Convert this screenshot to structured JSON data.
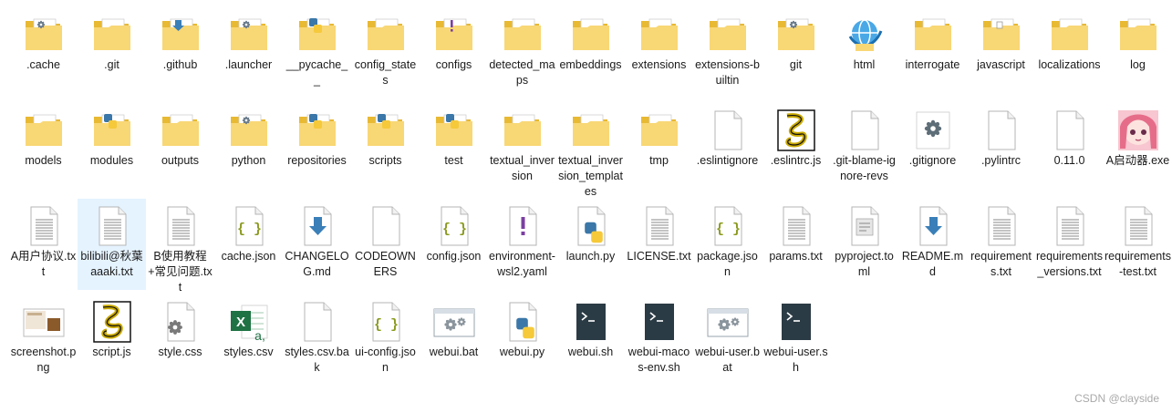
{
  "window": {
    "watermark": "CSDN @clayside"
  },
  "colors": {
    "folder_back": "#e8b933",
    "folder_front": "#f8d775",
    "selection": "#e5f3ff",
    "doc_line": "#8a8a8a",
    "json_brace": "#8a9a1e",
    "arrow_blue": "#3a7fb8",
    "python_blue": "#3b77a8",
    "python_yellow": "#f5c93a",
    "excel_green": "#1f7244",
    "terminal_bg": "#2b3b45",
    "gear_gray": "#7a7a7a"
  },
  "files": [
    {
      "name": ".cache",
      "icon": "folder-gear-icon",
      "type": "folder"
    },
    {
      "name": ".git",
      "icon": "folder-icon",
      "type": "folder"
    },
    {
      "name": ".github",
      "icon": "folder-download-icon",
      "type": "folder"
    },
    {
      "name": ".launcher",
      "icon": "folder-gear-icon",
      "type": "folder"
    },
    {
      "name": "__pycache__",
      "icon": "folder-python-icon",
      "type": "folder"
    },
    {
      "name": "config_states",
      "icon": "folder-icon",
      "type": "folder"
    },
    {
      "name": "configs",
      "icon": "folder-exclamation-icon",
      "type": "folder"
    },
    {
      "name": "detected_maps",
      "icon": "folder-icon",
      "type": "folder"
    },
    {
      "name": "embeddings",
      "icon": "folder-icon",
      "type": "folder"
    },
    {
      "name": "extensions",
      "icon": "folder-icon",
      "type": "folder"
    },
    {
      "name": "extensions-builtin",
      "icon": "folder-icon",
      "type": "folder"
    },
    {
      "name": "git",
      "icon": "folder-gear-icon",
      "type": "folder"
    },
    {
      "name": "html",
      "icon": "folder-web-icon",
      "type": "folder"
    },
    {
      "name": "interrogate",
      "icon": "folder-icon",
      "type": "folder"
    },
    {
      "name": "javascript",
      "icon": "folder-doc-icon",
      "type": "folder"
    },
    {
      "name": "localizations",
      "icon": "folder-icon",
      "type": "folder"
    },
    {
      "name": "log",
      "icon": "folder-icon",
      "type": "folder"
    },
    {
      "name": "models",
      "icon": "folder-icon",
      "type": "folder"
    },
    {
      "name": "modules",
      "icon": "folder-python-icon",
      "type": "folder"
    },
    {
      "name": "outputs",
      "icon": "folder-icon",
      "type": "folder"
    },
    {
      "name": "python",
      "icon": "folder-gear-icon",
      "type": "folder"
    },
    {
      "name": "repositories",
      "icon": "folder-python-icon",
      "type": "folder"
    },
    {
      "name": "scripts",
      "icon": "folder-python-icon",
      "type": "folder"
    },
    {
      "name": "test",
      "icon": "folder-python-icon",
      "type": "folder"
    },
    {
      "name": "textual_inversion",
      "icon": "folder-icon",
      "type": "folder"
    },
    {
      "name": "textual_inversion_templates",
      "icon": "folder-icon",
      "type": "folder"
    },
    {
      "name": "tmp",
      "icon": "folder-icon",
      "type": "folder"
    },
    {
      "name": ".eslintignore",
      "icon": "blank-file-icon",
      "type": "file"
    },
    {
      "name": ".eslintrc.js",
      "icon": "script-file-icon",
      "type": "file"
    },
    {
      "name": ".git-blame-ignore-revs",
      "icon": "blank-file-icon",
      "type": "file"
    },
    {
      "name": ".gitignore",
      "icon": "gear-file-icon",
      "type": "file"
    },
    {
      "name": ".pylintrc",
      "icon": "blank-file-icon",
      "type": "file"
    },
    {
      "name": "0.11.0",
      "icon": "blank-file-icon",
      "type": "file"
    },
    {
      "name": "A启动器.exe",
      "icon": "anime-app-icon",
      "type": "file"
    },
    {
      "name": "A用户协议.txt",
      "icon": "text-file-icon",
      "type": "file"
    },
    {
      "name": "bilibili@秋葉aaaki.txt",
      "icon": "text-file-icon",
      "type": "file",
      "selected": true
    },
    {
      "name": "B使用教程+常见问题.txt",
      "icon": "text-file-icon",
      "type": "file"
    },
    {
      "name": "cache.json",
      "icon": "json-file-icon",
      "type": "file"
    },
    {
      "name": "CHANGELOG.md",
      "icon": "markdown-file-icon",
      "type": "file"
    },
    {
      "name": "CODEOWNERS",
      "icon": "blank-file-icon",
      "type": "file"
    },
    {
      "name": "config.json",
      "icon": "json-file-icon",
      "type": "file"
    },
    {
      "name": "environment-wsl2.yaml",
      "icon": "yaml-file-icon",
      "type": "file"
    },
    {
      "name": "launch.py",
      "icon": "python-file-icon",
      "type": "file"
    },
    {
      "name": "LICENSE.txt",
      "icon": "text-file-icon",
      "type": "file"
    },
    {
      "name": "package.json",
      "icon": "json-file-icon",
      "type": "file"
    },
    {
      "name": "params.txt",
      "icon": "text-file-icon",
      "type": "file"
    },
    {
      "name": "pyproject.toml",
      "icon": "config-file-icon",
      "type": "file"
    },
    {
      "name": "README.md",
      "icon": "markdown-file-icon",
      "type": "file"
    },
    {
      "name": "requirements.txt",
      "icon": "text-file-icon",
      "type": "file"
    },
    {
      "name": "requirements_versions.txt",
      "icon": "text-file-icon",
      "type": "file"
    },
    {
      "name": "requirements-test.txt",
      "icon": "text-file-icon",
      "type": "file"
    },
    {
      "name": "screenshot.png",
      "icon": "image-file-icon",
      "type": "file"
    },
    {
      "name": "script.js",
      "icon": "script-file-icon",
      "type": "file"
    },
    {
      "name": "style.css",
      "icon": "css-file-icon",
      "type": "file"
    },
    {
      "name": "styles.csv",
      "icon": "excel-file-icon",
      "type": "file"
    },
    {
      "name": "styles.csv.bak",
      "icon": "blank-file-icon",
      "type": "file"
    },
    {
      "name": "ui-config.json",
      "icon": "json-file-icon",
      "type": "file"
    },
    {
      "name": "webui.bat",
      "icon": "batch-file-icon",
      "type": "file"
    },
    {
      "name": "webui.py",
      "icon": "python-file-icon",
      "type": "file"
    },
    {
      "name": "webui.sh",
      "icon": "shell-file-icon",
      "type": "file"
    },
    {
      "name": "webui-macos-env.sh",
      "icon": "shell-file-icon",
      "type": "file"
    },
    {
      "name": "webui-user.bat",
      "icon": "batch-file-icon",
      "type": "file"
    },
    {
      "name": "webui-user.sh",
      "icon": "shell-file-icon",
      "type": "file"
    }
  ]
}
